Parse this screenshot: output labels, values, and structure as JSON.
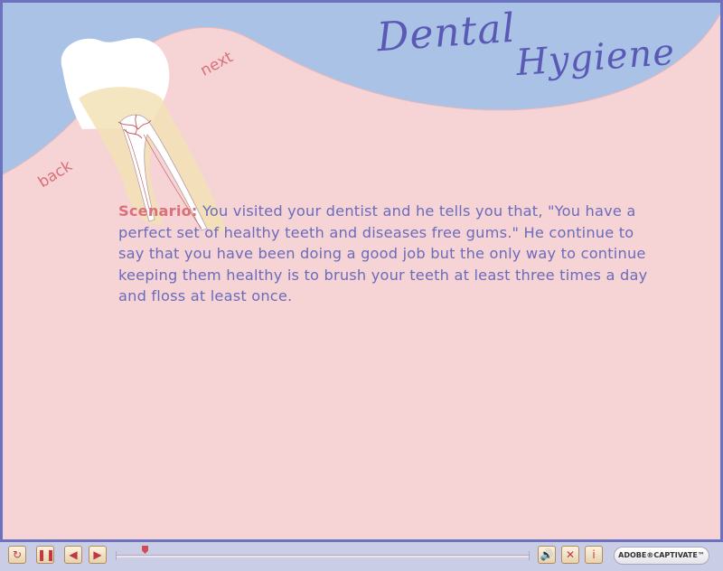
{
  "title": {
    "line1": "Dental",
    "line2": "Hygiene"
  },
  "nav": {
    "next_label": "next",
    "back_label": "back"
  },
  "scenario": {
    "label": "Scenario:",
    "text": " You visited your dentist and he tells you that, \"You have a perfect set of healthy teeth and diseases free gums.\" He continue to say that you have been doing a good job but the only way to continue keeping them healthy is to brush your teeth at least three times a day and floss at least once."
  },
  "playbar": {
    "logo_text": "ADOBE®CAPTIVATE™",
    "icons": [
      "rewind-icon",
      "pause-icon",
      "back-icon",
      "forward-icon",
      "audio-icon",
      "close-icon",
      "info-icon"
    ],
    "progress_fraction": 0.07
  },
  "colors": {
    "frame": "#6b73c0",
    "gum": "#f6d3d5",
    "sky": "#a9c2e6",
    "title": "#5a5ab4",
    "accent": "#d9707a",
    "body_text": "#6a6cbc"
  }
}
